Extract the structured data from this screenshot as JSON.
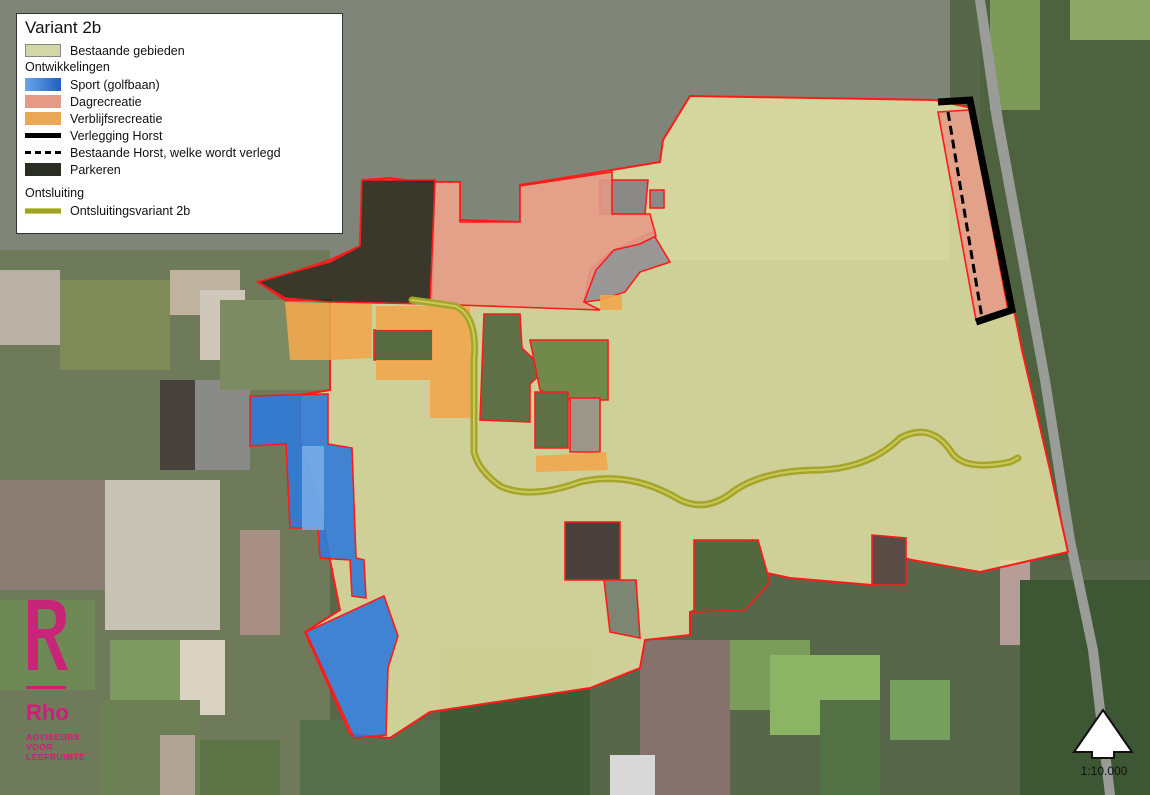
{
  "legend": {
    "title": "Variant 2b",
    "items": [
      {
        "label": "Bestaande gebieden",
        "color": "#d3d6a5"
      },
      {
        "label": "Ontwikkelingen"
      },
      {
        "label": "Sport (golfbaan)",
        "color": "#2f7ad8"
      },
      {
        "label": "Dagrecreatie",
        "color": "#e59a86"
      },
      {
        "label": "Verblijfsrecreatie",
        "color": "#e8a857"
      },
      {
        "label": "Verlegging Horst",
        "color": "#000000"
      },
      {
        "label": "Bestaande Horst, welke wordt verlegd",
        "color": "#000000"
      },
      {
        "label": "Parkeren",
        "color": "#2a2d24"
      },
      {
        "label": "Ontsluiting"
      },
      {
        "label": "Ontsluitingsvariant 2b",
        "color": "#9fa22a"
      }
    ]
  },
  "logo": {
    "brand": "Rho",
    "tagline_1": "ADVISEURS",
    "tagline_2": "VOOR",
    "tagline_3": "LEEFRUIMTE",
    "color": "#d01c7c"
  },
  "scale": {
    "text": "1:10.000"
  },
  "colors": {
    "boundary": "#ff1a1a",
    "existing": "#e3e2a4",
    "sport": "#2f7ad8",
    "dagrecreatie": "#e59a86",
    "verblijf": "#f0a64e",
    "parkeren": "#2c2a22",
    "route": "#a4a52a"
  }
}
